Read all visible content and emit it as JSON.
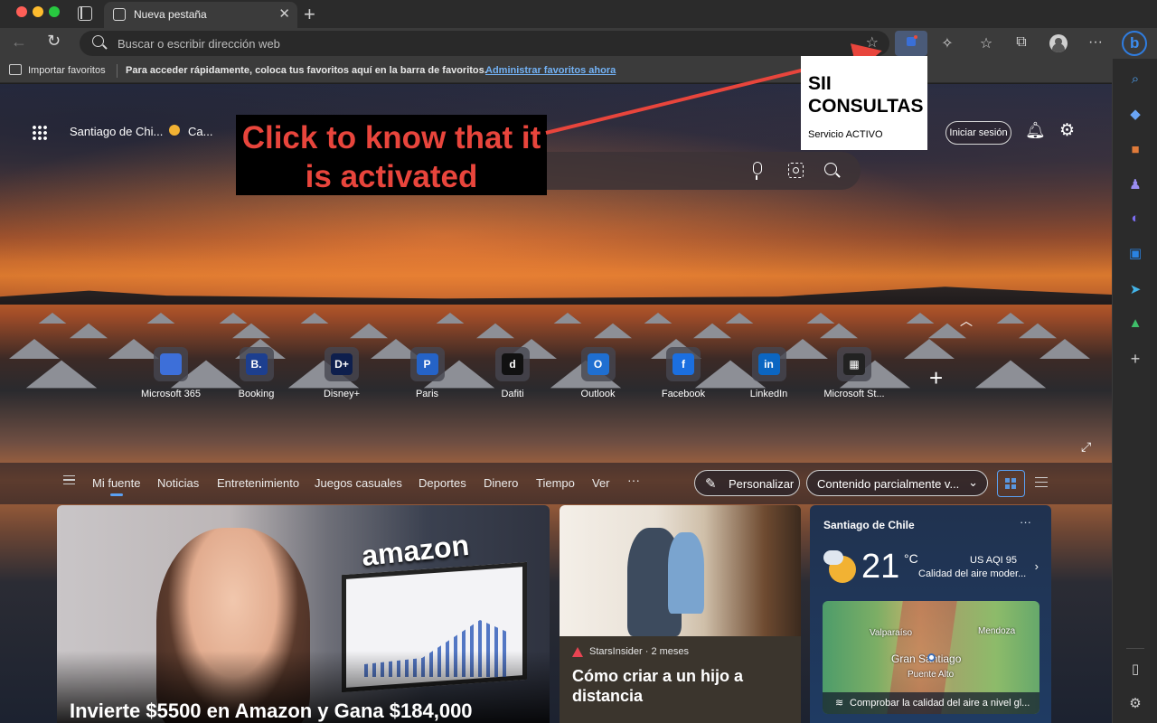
{
  "browser": {
    "tab_title": "Nueva pestaña",
    "address_placeholder": "Buscar o escribir dirección web"
  },
  "favorites_bar": {
    "import_label": "Importar favoritos",
    "message": "Para acceder rápidamente, coloca tus favoritos aquí en la barra de favoritos.",
    "manage_link": "Administrar favoritos ahora"
  },
  "newtab": {
    "location": "Santiago de Chi...",
    "weather_mini": "Ca...",
    "signin_label": "Iniciar sesión"
  },
  "annotation": {
    "text": "Click to know that it is activated",
    "color": "#e8453c"
  },
  "extension_popup": {
    "title": "SII CONSULTAS",
    "status": "Servicio ACTIVO"
  },
  "quick_links": [
    {
      "label": "Microsoft 365",
      "icon": "microsoft-365-icon",
      "color": "#3d6fd9",
      "glyph": ""
    },
    {
      "label": "Booking",
      "icon": "booking-icon",
      "color": "#1d3f8f",
      "glyph": "B."
    },
    {
      "label": "Disney+",
      "icon": "disney-plus-icon",
      "color": "#0e1f4d",
      "glyph": "D+"
    },
    {
      "label": "Paris",
      "icon": "paris-icon",
      "color": "#2563c7",
      "glyph": "P"
    },
    {
      "label": "Dafiti",
      "icon": "dafiti-icon",
      "color": "#111111",
      "glyph": "d"
    },
    {
      "label": "Outlook",
      "icon": "outlook-icon",
      "color": "#1f6fd1",
      "glyph": "O"
    },
    {
      "label": "Facebook",
      "icon": "facebook-icon",
      "color": "#1b6fe0",
      "glyph": "f"
    },
    {
      "label": "LinkedIn",
      "icon": "linkedin-icon",
      "color": "#0b66c2",
      "glyph": "in"
    },
    {
      "label": "Microsoft St...",
      "icon": "microsoft-store-icon",
      "color": "#222222",
      "glyph": "▦"
    }
  ],
  "feed_nav": {
    "tabs": [
      "Mi fuente",
      "Noticias",
      "Entretenimiento",
      "Juegos casuales",
      "Deportes",
      "Dinero",
      "Tiempo",
      "Ver"
    ],
    "more": "···",
    "personalize_label": "Personalizar",
    "content_select_value": "Contenido parcialmente v..."
  },
  "cards": {
    "main": {
      "brand_text": "amazon",
      "headline": "Invierte $5500 en Amazon y Gana $184,000"
    },
    "second": {
      "source": "StarsInsider · 2 meses",
      "headline": "Cómo criar a un hijo a distancia"
    },
    "weather": {
      "city": "Santiago de Chile",
      "more": "···",
      "temperature": "21",
      "unit": "°C",
      "aqi": "US AQI 95",
      "aqi_label": "Calidad del aire moder...",
      "map_cities": [
        "Valparaíso",
        "Mendoza",
        "Gran Santiago",
        "Puente Alto"
      ],
      "footer": "Comprobar la calidad del aire a nivel gl..."
    }
  }
}
